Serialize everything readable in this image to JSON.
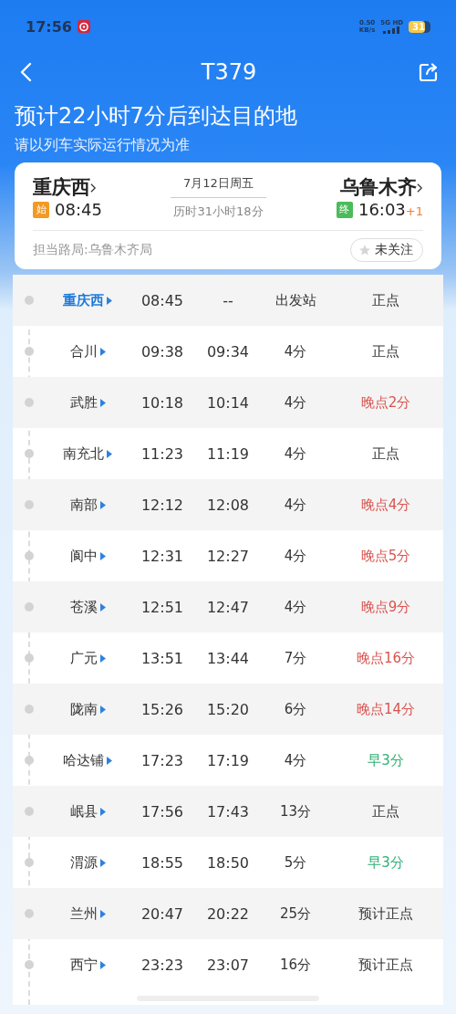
{
  "status_bar": {
    "time": "17:56",
    "net_speed": "0.50",
    "net_unit": "KB/s",
    "net_type": "5G HD",
    "battery": "31"
  },
  "nav": {
    "title": "T379"
  },
  "headline": "预计22小时7分后到达目的地",
  "subtitle": "请以列车实际运行情况为准",
  "summary": {
    "from": "重庆西",
    "to": "乌鲁木齐",
    "date": "7月12日周五",
    "duration": "历时31小时18分",
    "start_badge": "始",
    "start_time": "08:45",
    "end_badge": "终",
    "end_time": "16:03",
    "day_offset": "+1",
    "bureau": "担当路局:乌鲁木齐局",
    "follow": {
      "label": "未关注",
      "selected": false
    }
  },
  "stops": [
    {
      "station": "重庆西",
      "selected": true,
      "column_2": "08:45",
      "column_3": "--",
      "stop": "出发站",
      "status": "正点",
      "kind": "ontime"
    },
    {
      "station": "合川",
      "selected": false,
      "column_2": "09:38",
      "column_3": "09:34",
      "stop": "4分",
      "status": "正点",
      "kind": "ontime"
    },
    {
      "station": "武胜",
      "selected": false,
      "column_2": "10:18",
      "column_3": "10:14",
      "stop": "4分",
      "status": "晚点2分",
      "kind": "late"
    },
    {
      "station": "南充北",
      "selected": false,
      "column_2": "11:23",
      "column_3": "11:19",
      "stop": "4分",
      "status": "正点",
      "kind": "ontime"
    },
    {
      "station": "南部",
      "selected": false,
      "column_2": "12:12",
      "column_3": "12:08",
      "stop": "4分",
      "status": "晚点4分",
      "kind": "late"
    },
    {
      "station": "阆中",
      "selected": false,
      "column_2": "12:31",
      "column_3": "12:27",
      "stop": "4分",
      "status": "晚点5分",
      "kind": "late"
    },
    {
      "station": "苍溪",
      "selected": false,
      "column_2": "12:51",
      "column_3": "12:47",
      "stop": "4分",
      "status": "晚点9分",
      "kind": "late"
    },
    {
      "station": "广元",
      "selected": false,
      "column_2": "13:51",
      "column_3": "13:44",
      "stop": "7分",
      "status": "晚点16分",
      "kind": "late"
    },
    {
      "station": "陇南",
      "selected": false,
      "column_2": "15:26",
      "column_3": "15:20",
      "stop": "6分",
      "status": "晚点14分",
      "kind": "late"
    },
    {
      "station": "哈达铺",
      "selected": false,
      "column_2": "17:23",
      "column_3": "17:19",
      "stop": "4分",
      "status": "早3分",
      "kind": "early"
    },
    {
      "station": "岷县",
      "selected": false,
      "column_2": "17:56",
      "column_3": "17:43",
      "stop": "13分",
      "status": "正点",
      "kind": "ontime"
    },
    {
      "station": "渭源",
      "selected": false,
      "column_2": "18:55",
      "column_3": "18:50",
      "stop": "5分",
      "status": "早3分",
      "kind": "early"
    },
    {
      "station": "兰州",
      "selected": false,
      "column_2": "20:47",
      "column_3": "20:22",
      "stop": "25分",
      "status": "预计正点",
      "kind": "expected"
    },
    {
      "station": "西宁",
      "selected": false,
      "column_2": "23:23",
      "column_3": "23:07",
      "stop": "16分",
      "status": "预计正点",
      "kind": "expected"
    }
  ]
}
